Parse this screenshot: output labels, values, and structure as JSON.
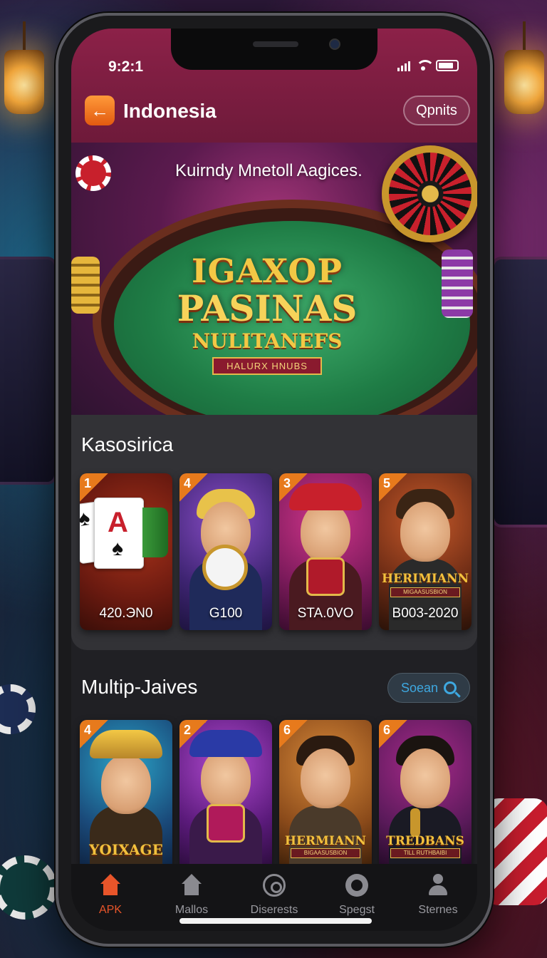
{
  "status_bar": {
    "time": "9:2:1"
  },
  "header": {
    "title": "Indonesia",
    "back_icon": "arrow-left-icon",
    "options_label": "Qpnits"
  },
  "banner": {
    "tagline": "Kuirndy Mnetoll Aagices.",
    "logo_line1": "IGAXOP",
    "logo_line2": "PASINAS",
    "logo_line3": "NULITANEFS",
    "logo_ribbon": "HALURX HNUBS"
  },
  "section1": {
    "title": "Kasosirica",
    "cards": [
      {
        "rank": "1",
        "caption": "420.ЭN0",
        "art": "playing-cards"
      },
      {
        "rank": "4",
        "caption": "G100",
        "art": "boy-with-clock"
      },
      {
        "rank": "3",
        "caption": "STA.0VO",
        "art": "girl-with-red-hat"
      },
      {
        "rank": "5",
        "caption": "B003-2020",
        "art": "bearded-man",
        "gold_title": "HERIMIANN",
        "gold_sub": "MIGAASUSBION"
      }
    ]
  },
  "section2": {
    "title": "Multip-Jaives",
    "search_label": "Soean",
    "cards": [
      {
        "rank": "4",
        "gold_title": "YOIXAGE",
        "art": "man-with-crown"
      },
      {
        "rank": "2",
        "art": "woman-with-blue-hat"
      },
      {
        "rank": "6",
        "gold_title": "HERMIANN",
        "gold_sub": "BIGAASUSBION",
        "art": "bearded-man"
      },
      {
        "rank": "6",
        "gold_title": "TREDBANS",
        "gold_sub": "TILL RUTHBAIBI",
        "art": "singer-with-mic"
      }
    ]
  },
  "bottom_nav": [
    {
      "label": "APK",
      "icon": "home-icon",
      "active": true
    },
    {
      "label": "Mallos",
      "icon": "home-icon",
      "active": false
    },
    {
      "label": "Diserests",
      "icon": "disc-icon",
      "active": false
    },
    {
      "label": "Spegst",
      "icon": "gear-icon",
      "active": false
    },
    {
      "label": "Sternes",
      "icon": "person-icon",
      "active": false
    }
  ],
  "colors": {
    "header": "#8c2148",
    "accent": "#e8552a",
    "search": "#3ea8e0"
  }
}
